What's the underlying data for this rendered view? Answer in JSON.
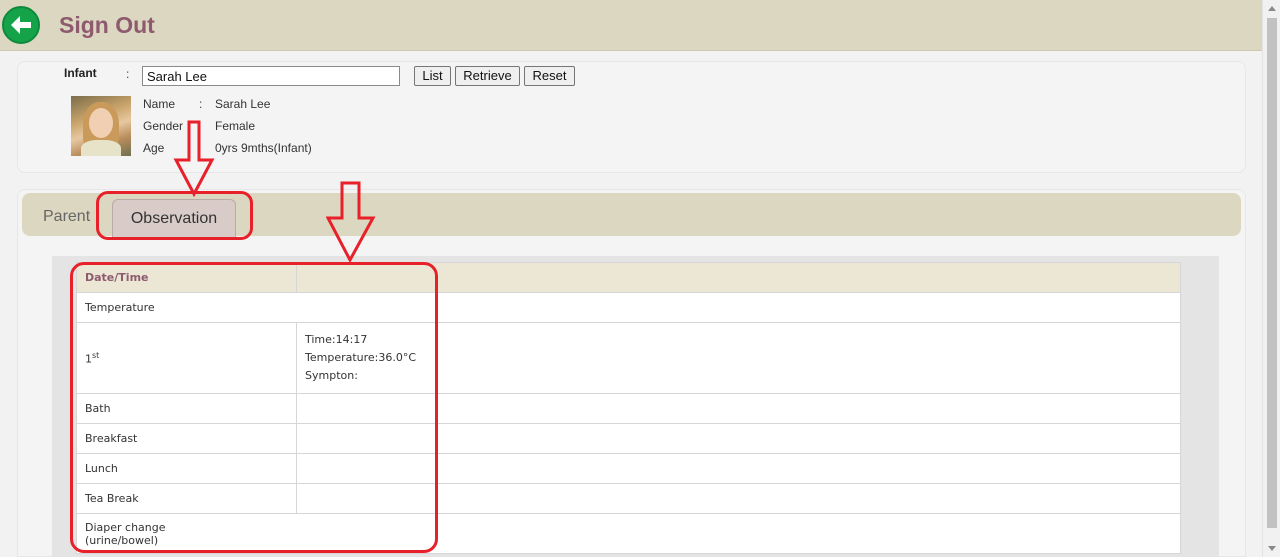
{
  "header": {
    "title": "Sign Out"
  },
  "search": {
    "label": "Infant",
    "colon": ":",
    "value": "Sarah Lee",
    "buttons": {
      "list": "List",
      "retrieve": "Retrieve",
      "reset": "Reset"
    }
  },
  "profile": {
    "name_label": "Name",
    "name_value": "Sarah Lee",
    "gender_label": "Gender",
    "gender_value": "Female",
    "age_label": "Age",
    "age_value": "0yrs 9mths(Infant)",
    "colon": ":"
  },
  "tabs": [
    {
      "label": "Parent",
      "active": false
    },
    {
      "label": "Observation",
      "active": true
    }
  ],
  "table": {
    "header": "Date/Time",
    "rows": {
      "temperature": "Temperature",
      "first": "1",
      "first_sup": "st",
      "first_time": "Time:14:17",
      "first_temp": "Temperature:36.0°C",
      "first_symptom": "Sympton:",
      "bath": "Bath",
      "breakfast": "Breakfast",
      "lunch": "Lunch",
      "teabreak": "Tea Break",
      "diaper_line1": "Diaper change",
      "diaper_line2": "(urine/bowel)"
    }
  },
  "colors": {
    "accent": "#8e5a6e",
    "annotation": "#e8202a",
    "back_button": "#15a34a"
  }
}
